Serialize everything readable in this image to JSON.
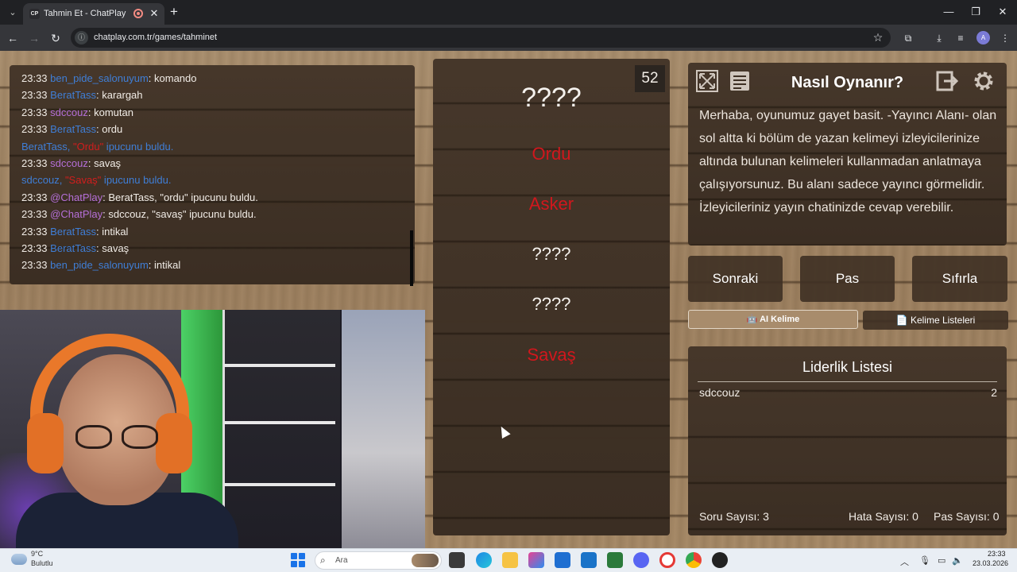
{
  "browser": {
    "tab_title": "Tahmin Et - ChatPlay",
    "tab_favicon": "CP",
    "url": "chatplay.com.tr/games/tahminet",
    "profile_initial": "A"
  },
  "chat": {
    "lines": [
      {
        "time": "23:33",
        "user": "ben_pide_salonuyum",
        "user_color": "#3f7ed6",
        "msg": ": komando"
      },
      {
        "time": "23:33",
        "user": "BeratTass",
        "user_color": "#3f7ed6",
        "msg": ": karargah"
      },
      {
        "time": "23:33",
        "user": "sdccouz",
        "user_color": "#b56fd8",
        "msg": ": komutan"
      },
      {
        "time": "23:33",
        "user": "BeratTass",
        "user_color": "#3f7ed6",
        "msg": ": ordu"
      },
      {
        "time": "",
        "user": "BeratTass,",
        "user_color": "#3f7ed6",
        "word": "\"Ordu\"",
        "msg": " ipucunu buldu."
      },
      {
        "time": "23:33",
        "user": "sdccouz",
        "user_color": "#b56fd8",
        "msg": ": savaş"
      },
      {
        "time": "",
        "user": "sdccouz,",
        "user_color": "#3f7ed6",
        "word": "\"Savaş\"",
        "msg": " ipucunu buldu."
      },
      {
        "time": "23:33",
        "user": "@ChatPlay",
        "user_color": "#b56fd8",
        "msg": ": BeratTass, \"ordu\" ipucunu buldu."
      },
      {
        "time": "23:33",
        "user": "@ChatPlay",
        "user_color": "#b56fd8",
        "msg": ": sdccouz, \"savaş\" ipucunu buldu."
      },
      {
        "time": "23:33",
        "user": "BeratTass",
        "user_color": "#3f7ed6",
        "msg": ": intikal"
      },
      {
        "time": "23:33",
        "user": "BeratTass",
        "user_color": "#3f7ed6",
        "msg": ": savaş"
      },
      {
        "time": "23:33",
        "user": "ben_pide_salonuyum",
        "user_color": "#3f7ed6",
        "msg": ": intikal"
      }
    ]
  },
  "game": {
    "timer": "52",
    "main_word": "????",
    "hints": [
      "Ordu",
      "Asker",
      "????",
      "????",
      "Savaş"
    ],
    "hint_found": [
      true,
      true,
      false,
      false,
      true
    ],
    "found_color": "#d1171d"
  },
  "help": {
    "title": "Nasıl Oynanır?",
    "text": "Merhaba, oyunumuz gayet basit. -Yayıncı Alanı- olan sol altta ki bölüm de yazan kelimeyi izleyicilerinize altında bulunan kelimeleri kullanmadan anlatmaya çalışıyorsunuz. Bu alanı sadece yayıncı görmelidir. İzleyicileriniz yayın chatinizde cevap verebilir."
  },
  "controls": {
    "next": "Sonraki",
    "pass": "Pas",
    "reset": "Sıfırla",
    "ai_tab": "AI Kelime",
    "ai_tab_icon": "🤖",
    "lists_tab": "Kelime Listeleri",
    "lists_tab_icon": "📄"
  },
  "leaderboard": {
    "title": "Liderlik Listesi",
    "rows": [
      {
        "name": "sdccouz",
        "score": "2"
      }
    ],
    "question_count": "Soru Sayısı: 3",
    "error_count": "Hata Sayısı: 0",
    "pass_count": "Pas Sayısı: 0"
  },
  "taskbar": {
    "weather_temp": "9°C",
    "weather_desc": "Bulutlu",
    "search_placeholder": "Ara",
    "time": "23:33",
    "date": "23.03.2026"
  }
}
